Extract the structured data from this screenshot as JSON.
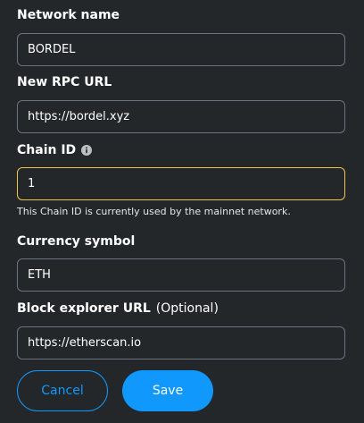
{
  "form": {
    "network_name": {
      "label": "Network name",
      "value": "BORDEL"
    },
    "rpc_url": {
      "label": "New RPC URL",
      "value": "https://bordel.xyz"
    },
    "chain_id": {
      "label": "Chain ID",
      "info_icon": "info-icon",
      "value": "1",
      "warning": "This Chain ID is currently used by the mainnet network."
    },
    "currency_symbol": {
      "label": "Currency symbol",
      "value": "ETH"
    },
    "block_explorer": {
      "label": "Block explorer URL",
      "optional": "(Optional)",
      "value": "https://etherscan.io"
    }
  },
  "actions": {
    "cancel_label": "Cancel",
    "save_label": "Save"
  },
  "colors": {
    "background": "#24272a",
    "primary": "#1098fc",
    "warning_border": "#f0c24b",
    "input_border": "#6a737d"
  }
}
